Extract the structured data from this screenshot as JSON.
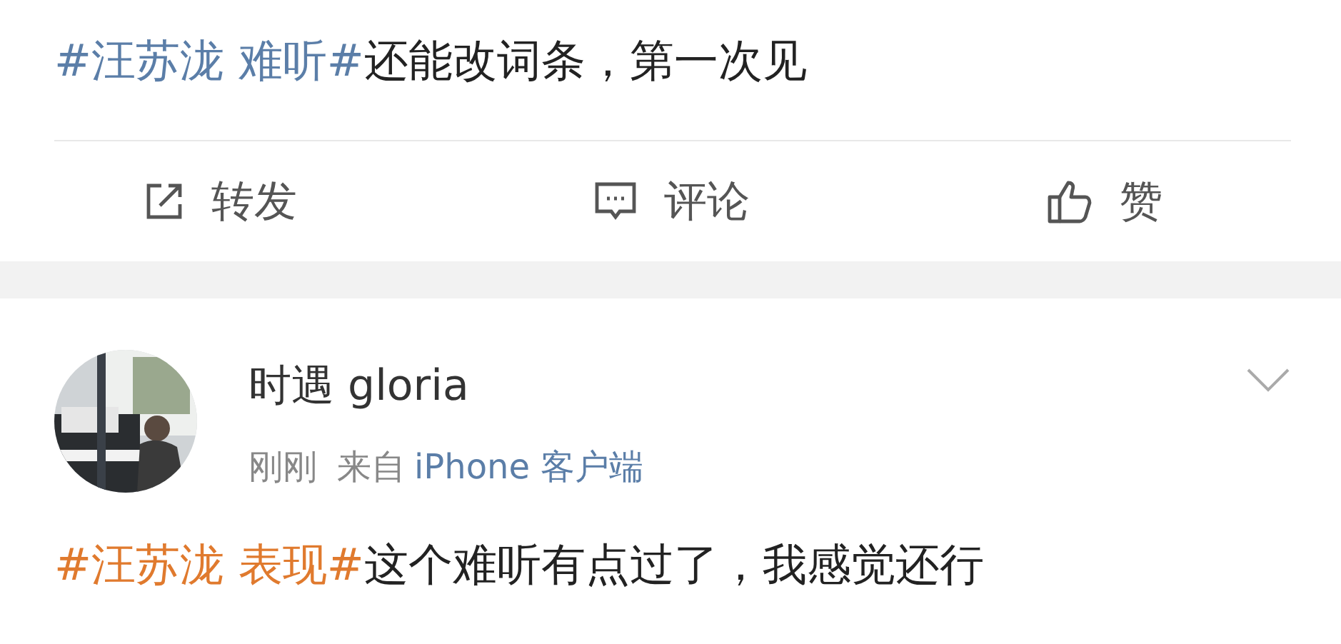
{
  "post_top": {
    "text": "**#汪苏泷 难听#**还能改词条，第一次见"
  },
  "actions": [
    {
      "kind": "repost",
      "label": "转发"
    },
    {
      "kind": "comment",
      "label": "评论"
    },
    {
      "kind": "like",
      "label": "赞"
    }
  ],
  "comment": {
    "user": "时遇 gloria",
    "time": "刚刚",
    "source_prefix": "来自",
    "source": "iPhone 客户端",
    "lines": [
      "**#汪苏泷 表现#**这个难听有点过了，我感觉还行"
    ]
  }
}
